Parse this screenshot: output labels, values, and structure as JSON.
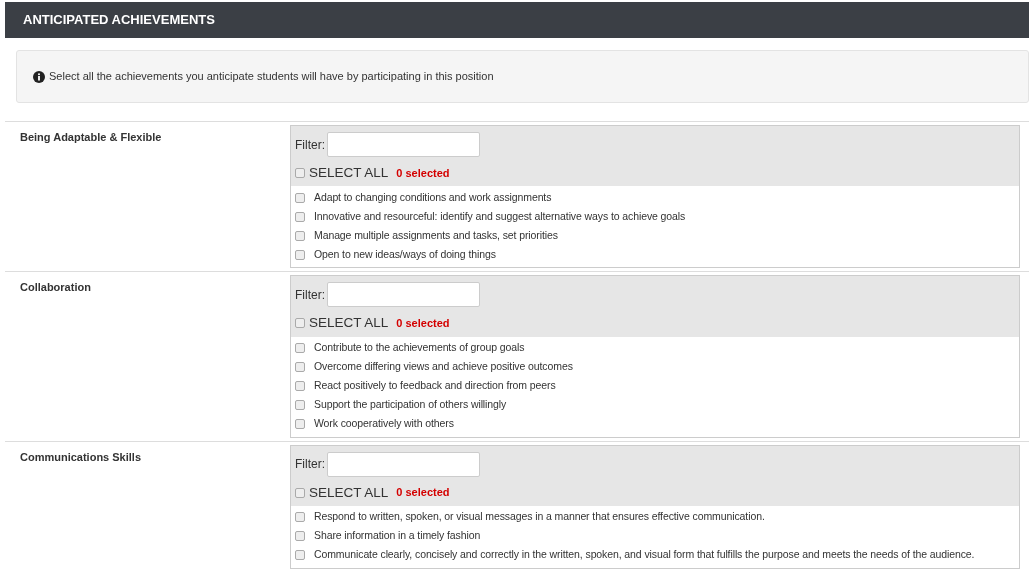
{
  "header": {
    "title": "ANTICIPATED ACHIEVEMENTS"
  },
  "info": {
    "text": "Select all the achievements you anticipate students will have by participating in this position"
  },
  "sections": [
    {
      "name": "Being Adaptable & Flexible",
      "filter_label": "Filter:",
      "select_all": {
        "label": "SELECT ALL",
        "checked": false
      },
      "count": "0 selected",
      "items": [
        {
          "label": "Adapt to changing conditions and work assignments",
          "checked": false
        },
        {
          "label": "Innovative and resourceful: identify and suggest alternative ways to achieve goals",
          "checked": false
        },
        {
          "label": "Manage multiple assignments and tasks, set priorities",
          "checked": false
        },
        {
          "label": "Open to new ideas/ways of doing things",
          "checked": false
        }
      ]
    },
    {
      "name": "Collaboration",
      "filter_label": "Filter:",
      "select_all": {
        "label": "SELECT ALL",
        "checked": false
      },
      "count": "0 selected",
      "items": [
        {
          "label": "Contribute to the achievements of group goals",
          "checked": false
        },
        {
          "label": "Overcome differing views and achieve positive outcomes",
          "checked": false
        },
        {
          "label": "React positively to feedback and direction from peers",
          "checked": false
        },
        {
          "label": "Support the participation of others willingly",
          "checked": false
        },
        {
          "label": "Work cooperatively with others",
          "checked": false
        }
      ]
    },
    {
      "name": "Communications Skills",
      "filter_label": "Filter:",
      "select_all": {
        "label": "SELECT ALL",
        "checked": false
      },
      "count": "0 selected",
      "items": [
        {
          "label": "Respond to written, spoken, or visual messages in a manner that ensures effective communication.",
          "checked": false
        },
        {
          "label": "Share information in a timely fashion",
          "checked": false
        },
        {
          "label": "Communicate clearly, concisely and correctly in the written, spoken, and visual form that fulfills the purpose and meets the needs of the audience.",
          "checked": false
        }
      ]
    }
  ]
}
